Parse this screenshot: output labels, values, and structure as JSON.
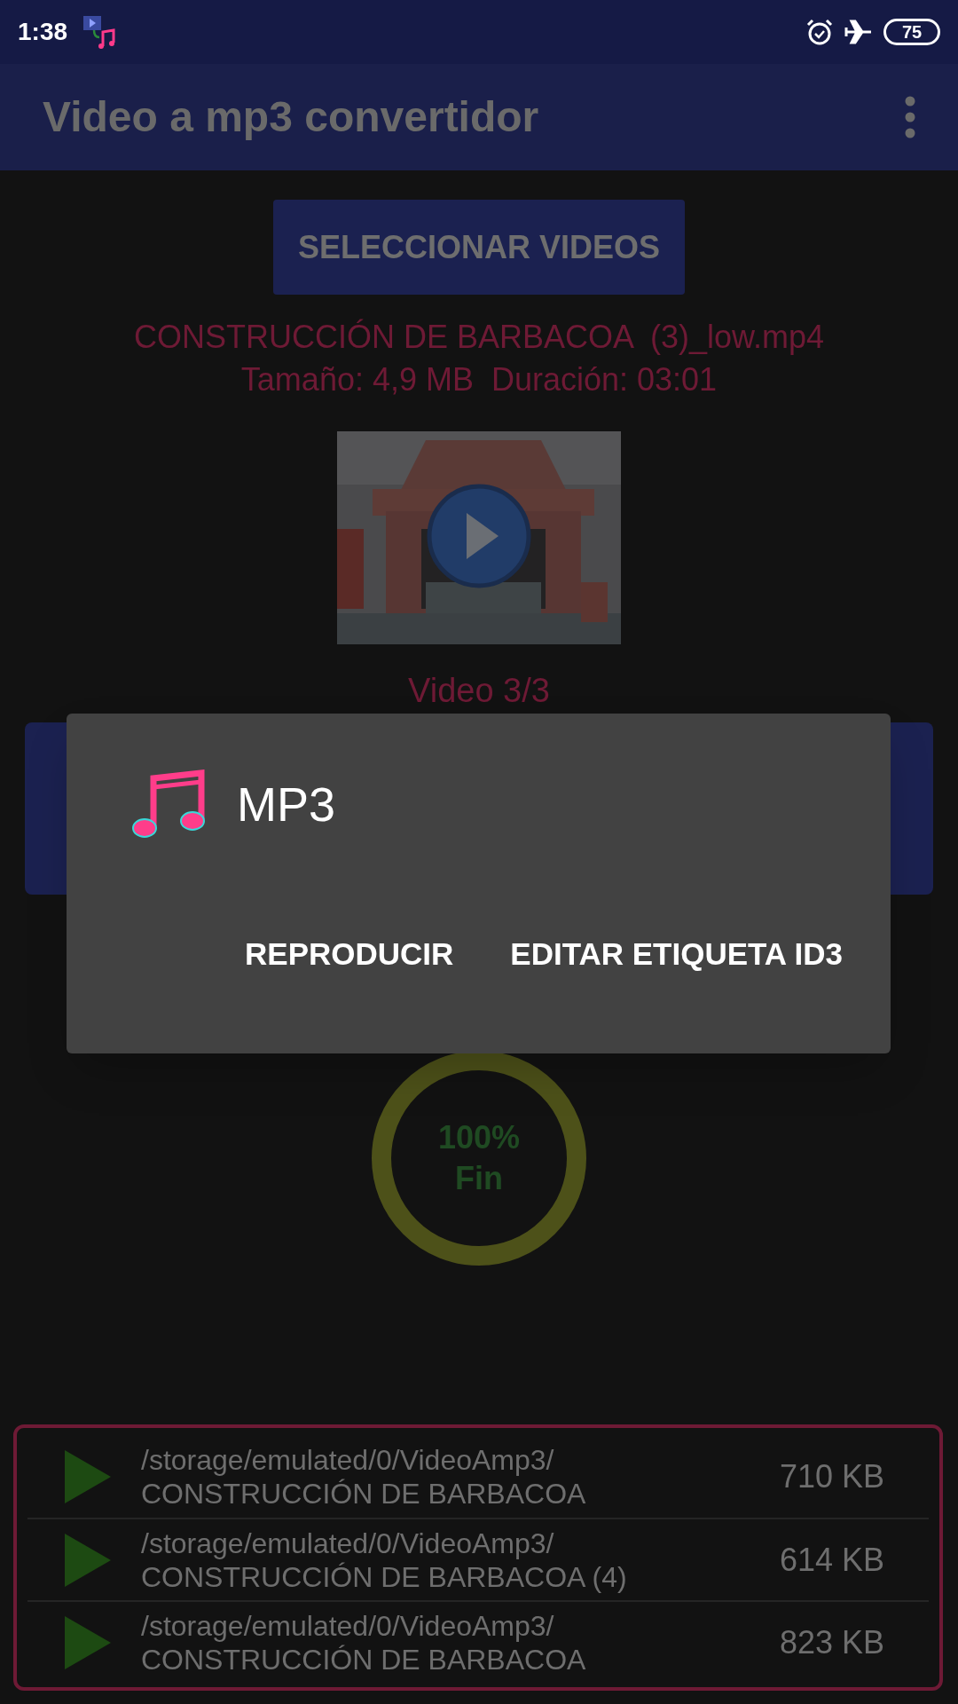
{
  "status_bar": {
    "time": "1:38",
    "battery": "75"
  },
  "app_bar": {
    "title": "Video a mp3 convertidor"
  },
  "select_button": "SELECCIONAR VIDEOS",
  "video": {
    "name": "CONSTRUCCIÓN DE BARBACOA  (3)_low.mp4",
    "info": "Tamaño: 4,9 MB  Duración: 03:01",
    "counter": "Video 3/3"
  },
  "progress": {
    "percent": "100%",
    "label": "Fin"
  },
  "dialog": {
    "title": "MP3",
    "buttons": [
      "REPRODUCIR",
      "EDITAR ETIQUETA ID3"
    ]
  },
  "files": {
    "rows": [
      {
        "path": "/storage/emulated/0/VideoAmp3/",
        "name": "CONSTRUCCIÓN DE BARBACOA",
        "size": "710 KB"
      },
      {
        "path": "/storage/emulated/0/VideoAmp3/",
        "name": "CONSTRUCCIÓN DE BARBACOA (4)",
        "size": "614 KB"
      },
      {
        "path": "/storage/emulated/0/VideoAmp3/",
        "name": "CONSTRUCCIÓN DE BARBACOA",
        "size": "823 KB"
      }
    ]
  }
}
